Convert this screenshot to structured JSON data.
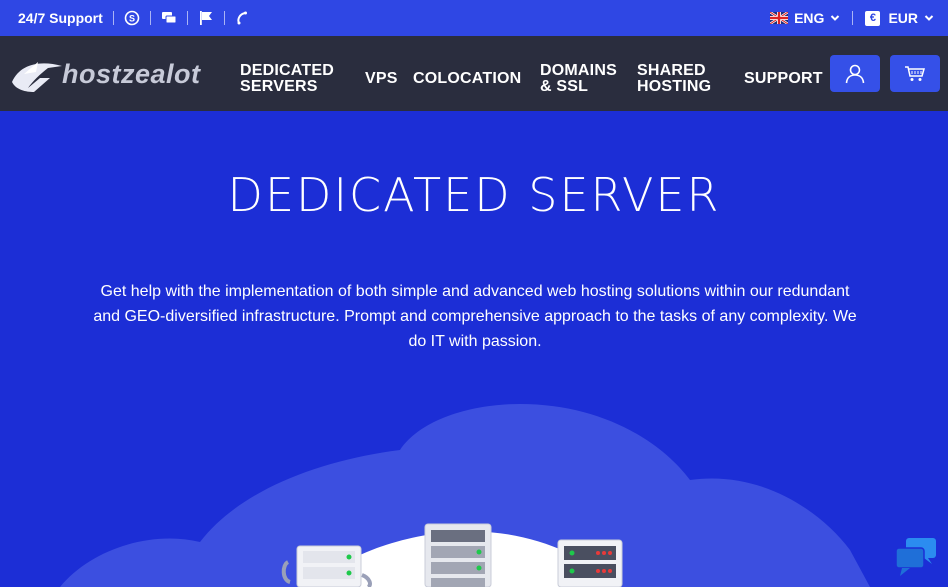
{
  "topbar": {
    "support_label": "24/7 Support",
    "icons": [
      "skype-icon",
      "chat-icon",
      "flag-icon",
      "phone-icon"
    ],
    "language": "ENG",
    "currency": "EUR",
    "currency_symbol": "€"
  },
  "nav": {
    "logo_text": "hostzealot",
    "items": [
      {
        "line1": "DEDICATED",
        "line2": "SERVERS"
      },
      {
        "line1": "VPS",
        "line2": ""
      },
      {
        "line1": "COLOCATION",
        "line2": ""
      },
      {
        "line1": "DOMAINS",
        "line2": "& SSL"
      },
      {
        "line1": "SHARED",
        "line2": "HOSTING"
      },
      {
        "line1": "SUPPORT",
        "line2": ""
      }
    ]
  },
  "hero": {
    "title": "DEDICATED SERVER",
    "description": "Get help with the implementation of both simple and advanced web hosting solutions within our redundant and GEO-diversified infrastructure. Prompt and comprehensive approach to the tasks of any complexity. We do IT with passion."
  },
  "colors": {
    "topbar_bg": "#2f47e4",
    "nav_bg": "#2a2d3e",
    "hero_bg": "#1c2ed6",
    "accent_button": "#3550e8"
  }
}
